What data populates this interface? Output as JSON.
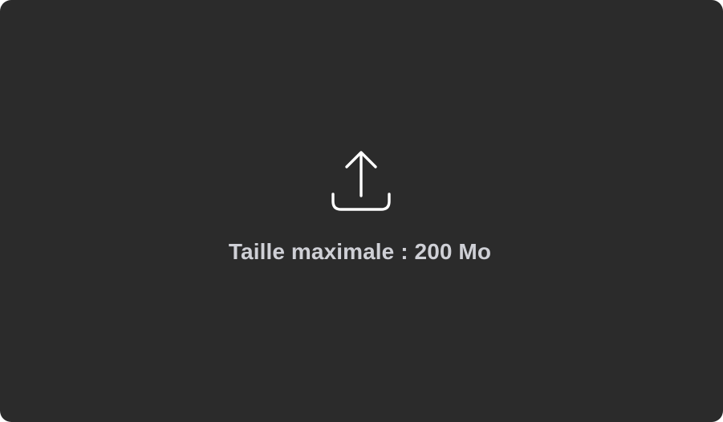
{
  "dropzone": {
    "icon": "upload-icon",
    "hint_text": "Taille maximale : 200 Mo"
  },
  "colors": {
    "background": "#2b2b2b",
    "icon": "#ffffff",
    "text": "#cfd0d6"
  }
}
